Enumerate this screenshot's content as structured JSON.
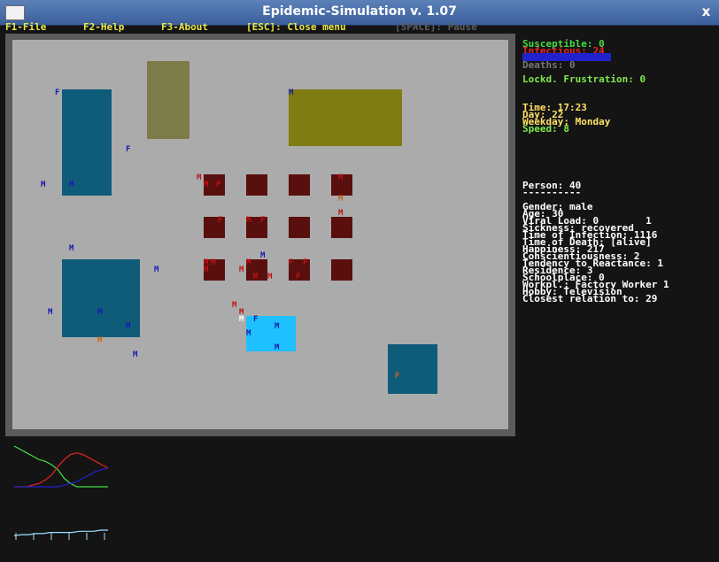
{
  "window": {
    "title": "Epidemic-Simulation v. 1.07",
    "close_glyph": "x"
  },
  "menu": {
    "file": "F1-File",
    "help": "F2-Help",
    "about": "F3-About",
    "close_menu": "[ESC]: Close menu",
    "pause": "[SPACE]: Pause"
  },
  "status": {
    "susceptible": "Susceptible: 0",
    "infectious": "Infectious: 24",
    "deaths": "Deaths: 0",
    "lockd_frustration": "Lockd. Frustration: 0",
    "time": "Time: 17:23",
    "day": "Day: 22",
    "weekday": "Weekday: Monday",
    "speed": "Speed: 8"
  },
  "person": {
    "header": "Person: 40",
    "underline": "----------",
    "gender": "Gender: male",
    "age": "Age: 30",
    "viral_load": "Viral Load: 0        1",
    "sickness": "Sickness: recovered",
    "time_of_infection": "Time of Infection: 1116",
    "time_of_death": "Time of Death: [alive]",
    "happiness": "Happiness: 217",
    "conscientiousness": "Conscientiousness: 2",
    "reactance": "Tendency to Reactance: 1",
    "residence": "Residence: 3",
    "schoolplace": "Schoolplace: 0",
    "workplace": "Workpl.: Factory Worker 1",
    "hobby": "Hobby: Television",
    "closest_relation": "Closest relation to: 29"
  },
  "colors": {
    "susceptible": "#44dd44",
    "infectious": "#ee2222",
    "recovered": "#2222cc",
    "deaths": "#777777",
    "status_green": "#7fe84f",
    "status_yellow": "#ffe066",
    "white_text": "#ffffff",
    "menu_yellow": "#e8e84a",
    "map_bg": "#ababab",
    "house_teal": "#0f5b7a",
    "house_olive": "#7b7c4a",
    "house_yellow": "#7f7c12",
    "workplace_dark_red": "#5a0f0f",
    "selected_cyan": "#1ec0ff",
    "marker_blue": "#1818b0",
    "marker_red": "#c01010",
    "marker_orange": "#c86814",
    "marker_white": "#ffffff"
  },
  "person_marker_letters": {
    "male": "M",
    "female": "F"
  },
  "chart_data": [
    {
      "type": "line",
      "description_of_series_colors": [
        "#44dd44",
        "#ee2222",
        "#2222cc"
      ],
      "series": [
        {
          "values": [
            24,
            22,
            20,
            18,
            16,
            15,
            13,
            10,
            5,
            2,
            0,
            0,
            0,
            0,
            0,
            0
          ]
        },
        {
          "values": [
            0,
            0,
            0,
            1,
            2,
            4,
            7,
            12,
            16,
            19,
            20,
            19,
            17,
            15,
            13,
            11
          ]
        },
        {
          "values": [
            0,
            0,
            0,
            0,
            0,
            0,
            0,
            0,
            1,
            2,
            3,
            5,
            7,
            9,
            10,
            11
          ]
        }
      ]
    },
    {
      "type": "line",
      "description_of_series_colors": [
        "#9ee0ff"
      ],
      "series": [
        {
          "values": [
            2,
            3,
            3,
            4,
            4,
            5,
            5,
            5,
            5,
            6,
            6,
            6,
            7,
            7
          ]
        }
      ]
    }
  ]
}
